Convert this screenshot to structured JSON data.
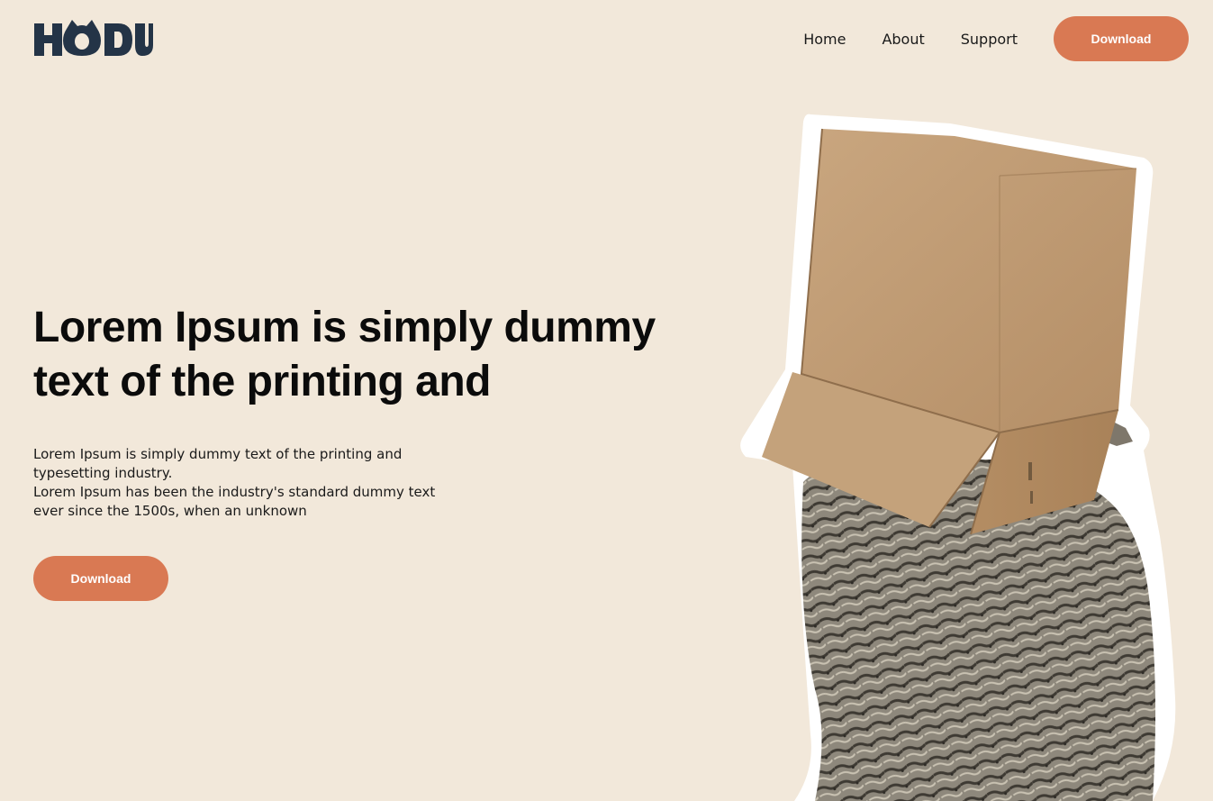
{
  "header": {
    "logo_text": "HODU",
    "nav": [
      {
        "label": "Home"
      },
      {
        "label": "About"
      },
      {
        "label": "Support"
      }
    ],
    "download_label": "Download"
  },
  "hero": {
    "title": "Lorem Ipsum is simply dummy text of the printing and",
    "description_lines": [
      "Lorem Ipsum is simply dummy text of the printing and typesetting industry.",
      "Lorem Ipsum has been the industry's standard dummy text ever since the 1500s, when an unknown"
    ],
    "download_label": "Download"
  },
  "colors": {
    "background": "#F2E8DA",
    "accent": "#D97953",
    "logo": "#243447"
  }
}
